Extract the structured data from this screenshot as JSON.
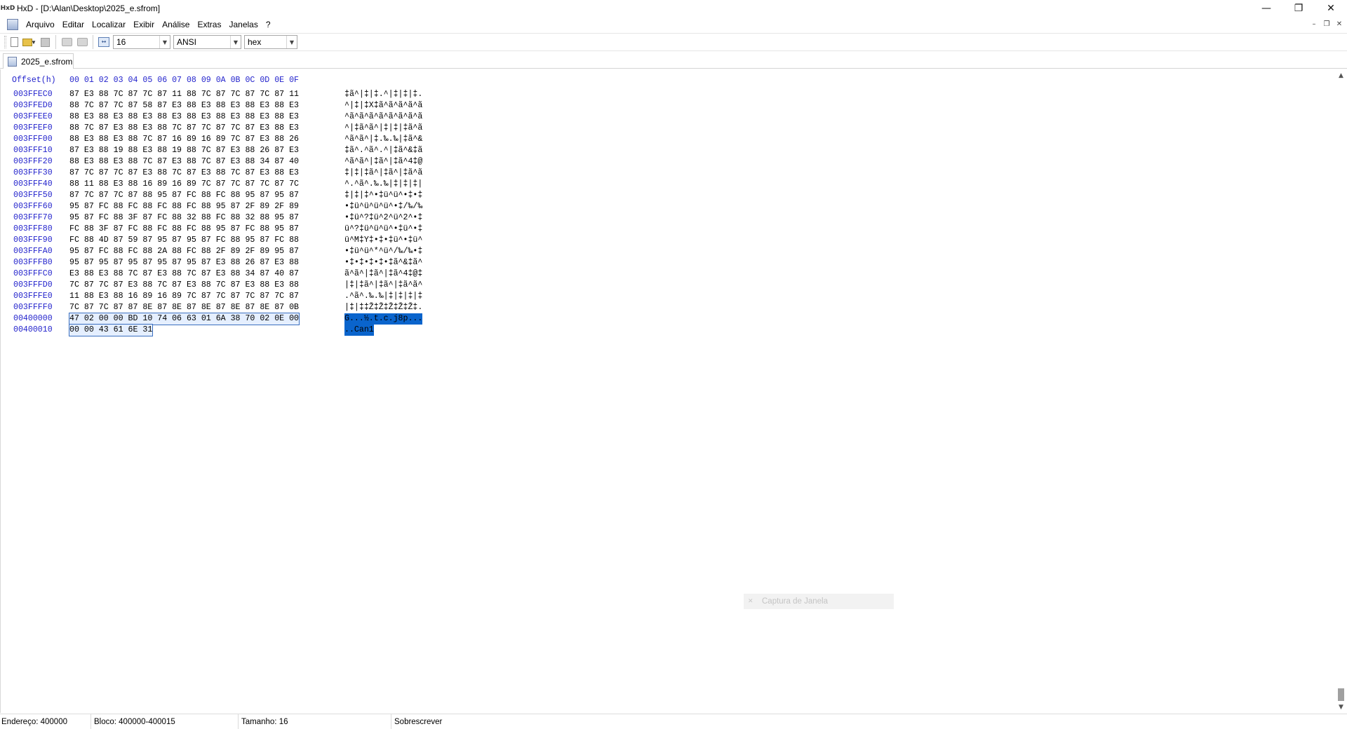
{
  "window": {
    "app_icon_label": "HxD",
    "title": "HxD - [D:\\Alan\\Desktop\\2025_e.sfrom]",
    "controls": {
      "minimize": "—",
      "restore": "❐",
      "close": "✕"
    }
  },
  "menu": {
    "items": [
      "Arquivo",
      "Editar",
      "Localizar",
      "Exibir",
      "Análise",
      "Extras",
      "Janelas",
      "?"
    ],
    "mdi": {
      "minimize": "–",
      "restore": "❐",
      "close": "✕"
    }
  },
  "toolbar": {
    "bytes_per_row": "16",
    "charset": "ANSI",
    "offset_base": "hex",
    "icons": [
      "new-file-icon",
      "open-file-icon",
      "save-icon",
      "cut-icon",
      "print-icon",
      "bytes-width-icon"
    ]
  },
  "tab": {
    "label": "2025_e.sfrom"
  },
  "editor": {
    "offset_header": "Offset(h)",
    "column_header": "00 01 02 03 04 05 06 07 08 09 0A 0B 0C 0D 0E 0F",
    "rows": [
      {
        "offset": "003FFEC0",
        "hex": "87 E3 88 7C 87 7C 87 11 88 7C 87 7C 87 7C 87 11",
        "text": "‡ã^|‡|‡.^|‡|‡|‡."
      },
      {
        "offset": "003FFED0",
        "hex": "88 7C 87 7C 87 58 87 E3 88 E3 88 E3 88 E3 88 E3",
        "text": "^|‡|‡X‡ã^ã^ã^ã^ã"
      },
      {
        "offset": "003FFEE0",
        "hex": "88 E3 88 E3 88 E3 88 E3 88 E3 88 E3 88 E3 88 E3",
        "text": "^ã^ã^ã^ã^ã^ã^ã^ã"
      },
      {
        "offset": "003FFEF0",
        "hex": "88 7C 87 E3 88 E3 88 7C 87 7C 87 7C 87 E3 88 E3",
        "text": "^|‡ã^ã^|‡|‡|‡ã^ã"
      },
      {
        "offset": "003FFF00",
        "hex": "88 E3 88 E3 88 7C 87 16 89 16 89 7C 87 E3 88 26",
        "text": "^ã^ã^|‡.‰.‰|‡ã^&"
      },
      {
        "offset": "003FFF10",
        "hex": "87 E3 88 19 88 E3 88 19 88 7C 87 E3 88 26 87 E3",
        "text": "‡ã^.^ã^.^|‡ã^&‡ã"
      },
      {
        "offset": "003FFF20",
        "hex": "88 E3 88 E3 88 7C 87 E3 88 7C 87 E3 88 34 87 40",
        "text": "^ã^ã^|‡ã^|‡ã^4‡@"
      },
      {
        "offset": "003FFF30",
        "hex": "87 7C 87 7C 87 E3 88 7C 87 E3 88 7C 87 E3 88 E3",
        "text": "‡|‡|‡ã^|‡ã^|‡ã^ã"
      },
      {
        "offset": "003FFF40",
        "hex": "88 11 88 E3 88 16 89 16 89 7C 87 7C 87 7C 87 7C",
        "text": "^.^ã^.‰.‰|‡|‡|‡|"
      },
      {
        "offset": "003FFF50",
        "hex": "87 7C 87 7C 87 88 95 87 FC 88 FC 88 95 87 95 87",
        "text": "‡|‡|‡^•‡ü^ü^•‡•‡"
      },
      {
        "offset": "003FFF60",
        "hex": "95 87 FC 88 FC 88 FC 88 FC 88 95 87 2F 89 2F 89",
        "text": "•‡ü^ü^ü^ü^•‡/‰/‰"
      },
      {
        "offset": "003FFF70",
        "hex": "95 87 FC 88 3F 87 FC 88 32 88 FC 88 32 88 95 87",
        "text": "•‡ü^?‡ü^2^ü^2^•‡"
      },
      {
        "offset": "003FFF80",
        "hex": "FC 88 3F 87 FC 88 FC 88 FC 88 95 87 FC 88 95 87",
        "text": "ü^?‡ü^ü^ü^•‡ü^•‡"
      },
      {
        "offset": "003FFF90",
        "hex": "FC 88 4D 87 59 87 95 87 95 87 FC 88 95 87 FC 88",
        "text": "ü^M‡Y‡•‡•‡ü^•‡ü^"
      },
      {
        "offset": "003FFFA0",
        "hex": "95 87 FC 88 FC 88 2A 88 FC 88 2F 89 2F 89 95 87",
        "text": "•‡ü^ü^*^ü^/‰/‰•‡"
      },
      {
        "offset": "003FFFB0",
        "hex": "95 87 95 87 95 87 95 87 95 87 E3 88 26 87 E3 88",
        "text": "•‡•‡•‡•‡•‡ã^&‡ã^"
      },
      {
        "offset": "003FFFC0",
        "hex": "E3 88 E3 88 7C 87 E3 88 7C 87 E3 88 34 87 40 87",
        "text": "ã^ã^|‡ã^|‡ã^4‡@‡"
      },
      {
        "offset": "003FFFD0",
        "hex": "7C 87 7C 87 E3 88 7C 87 E3 88 7C 87 E3 88 E3 88",
        "text": "|‡|‡ã^|‡ã^|‡ã^ã^"
      },
      {
        "offset": "003FFFE0",
        "hex": "11 88 E3 88 16 89 16 89 7C 87 7C 87 7C 87 7C 87",
        "text": ".^ã^.‰.‰|‡|‡|‡|‡"
      },
      {
        "offset": "003FFFF0",
        "hex": "7C 87 7C 87 87 8E 87 8E 87 8E 87 8E 87 8E 87 0B",
        "text": "|‡|‡‡Ž‡Ž‡Ž‡Ž‡Ž‡."
      },
      {
        "offset": "00400000",
        "hex": "47 02 00 00 BD 10 74 06 63 01 6A 38 70 02 0E 00",
        "text": "G...½.t.c.j8p...",
        "selected": true
      },
      {
        "offset": "00400010",
        "hex": "00 00 43 61 6E 31",
        "text": "..Can1",
        "selected": true
      }
    ]
  },
  "ghost_widget": {
    "icon": "✕",
    "label": "Captura de Janela"
  },
  "status": {
    "address": "Endereço: 400000",
    "block": "Bloco: 400000-400015",
    "size": "Tamanho: 16",
    "mode": "Sobrescrever"
  },
  "colors": {
    "offset_blue": "#2222cc",
    "selection_blue": "#0a64cc"
  }
}
